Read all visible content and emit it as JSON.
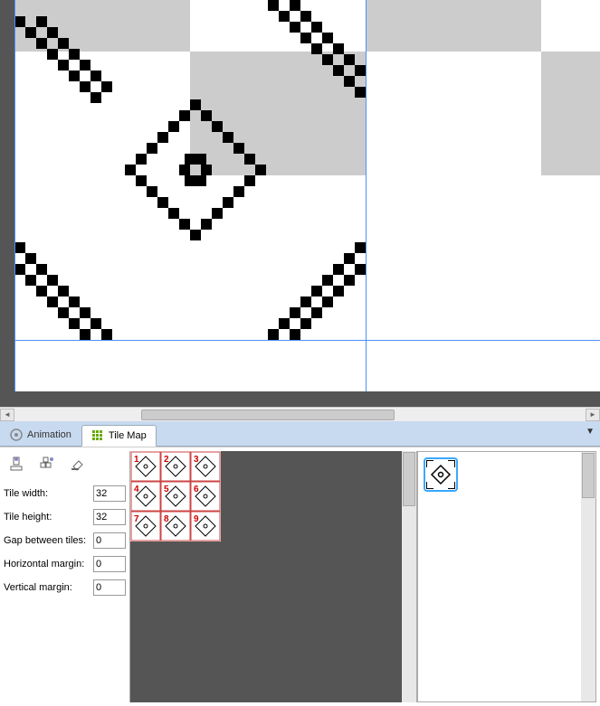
{
  "tabs": {
    "animation": "Animation",
    "tilemap": "Tile Map"
  },
  "form": {
    "tile_width_label": "Tile width:",
    "tile_width_value": "32",
    "tile_height_label": "Tile height:",
    "tile_height_value": "32",
    "gap_label": "Gap between tiles:",
    "gap_value": "0",
    "hmargin_label": "Horizontal margin:",
    "hmargin_value": "0",
    "vmargin_label": "Vertical margin:",
    "vmargin_value": "0"
  },
  "tileset": {
    "numbers": [
      "1",
      "2",
      "3",
      "4",
      "5",
      "6",
      "7",
      "8",
      "9"
    ]
  },
  "tools": {
    "stamp": "stamp-tool",
    "fill": "fill-tool",
    "erase": "erase-tool"
  }
}
